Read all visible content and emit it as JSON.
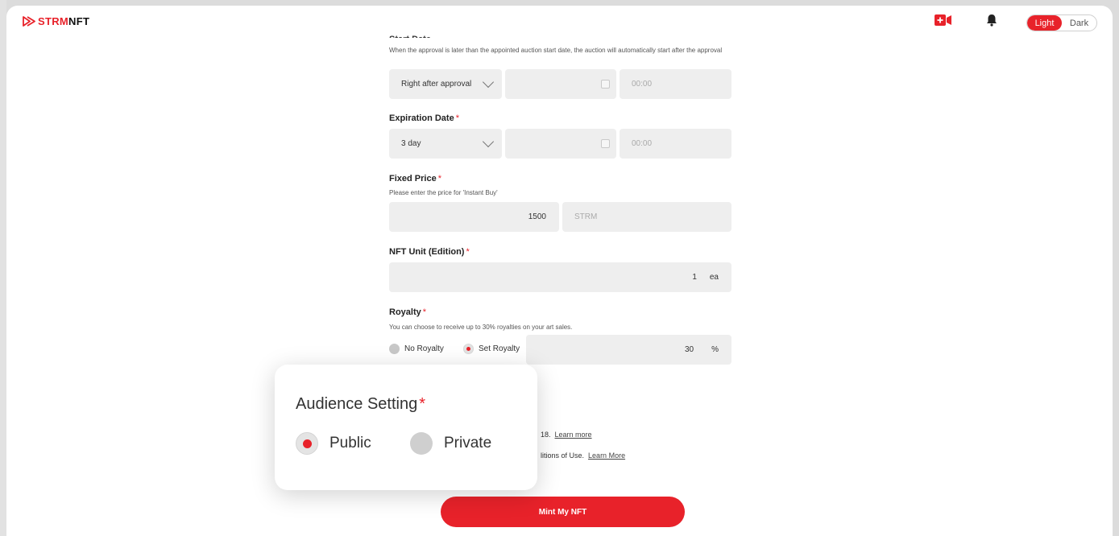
{
  "header": {
    "logo_prefix": "STRM",
    "logo_suffix": "NFT",
    "theme_light_label": "Light",
    "theme_dark_label": "Dark"
  },
  "form": {
    "auction_start": {
      "help": "When the approval is later than the appointed auction start date, the auction will automatically start after the approval",
      "select_value": "Right after approval",
      "time_placeholder": "00:00"
    },
    "expiration": {
      "label": "Expiration Date",
      "select_value": "3 day",
      "time_placeholder": "00:00"
    },
    "fixed_price": {
      "label": "Fixed Price",
      "help": "Please enter the price for 'Instant Buy'",
      "value": "1500",
      "unit": "STRM"
    },
    "nft_unit": {
      "label": "NFT Unit (Edition)",
      "value": "1",
      "unit": "ea"
    },
    "royalty": {
      "label": "Royalty",
      "help": "You can choose to receive up to 30% royalties on your art sales.",
      "options": [
        "No Royalty",
        "Set Royalty"
      ],
      "selected": "Set Royalty",
      "value": "30",
      "unit": "%"
    },
    "terms": {
      "age_fragment": "18.",
      "age_link": "Learn more",
      "conditions_fragment": "litions of Use.",
      "conditions_link": "Learn More"
    },
    "submit_label": "Mint My NFT"
  },
  "audience_popup": {
    "title": "Audience Setting",
    "options": [
      "Public",
      "Private"
    ],
    "selected": "Public"
  },
  "required_mark": "*",
  "colors": {
    "accent": "#e8222a",
    "field_bg": "#eeeeee"
  }
}
